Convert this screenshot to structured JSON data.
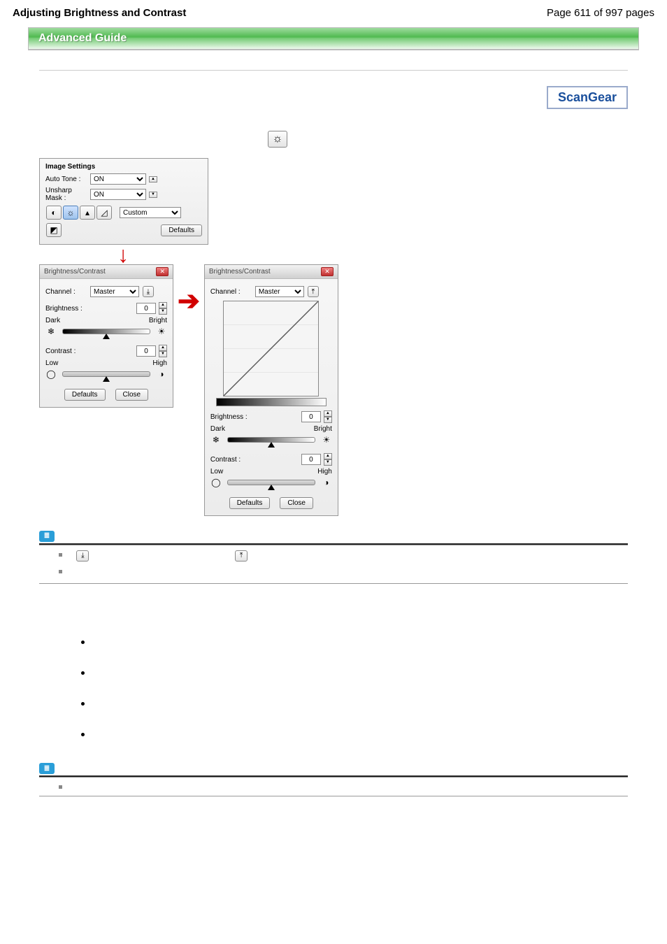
{
  "header": {
    "title": "Adjusting Brightness and Contrast",
    "page_info": "Page 611 of 997 pages"
  },
  "banner": "Advanced Guide",
  "brand": "ScanGear",
  "image_settings": {
    "title": "Image Settings",
    "rows": {
      "auto_tone_label": "Auto Tone :",
      "auto_tone_value": "ON",
      "unsharp_label": "Unsharp Mask :",
      "unsharp_value": "ON",
      "custom_value": "Custom"
    },
    "defaults_btn": "Defaults"
  },
  "dialog": {
    "title": "Brightness/Contrast",
    "channel_label": "Channel :",
    "channel_value": "Master",
    "brightness_label": "Brightness :",
    "brightness_value": "0",
    "dark": "Dark",
    "bright": "Bright",
    "contrast_label": "Contrast :",
    "contrast_value": "0",
    "low": "Low",
    "high": "High",
    "defaults": "Defaults",
    "close": "Close"
  },
  "icons": {
    "main": "☀",
    "expand": "⤓",
    "collapse": "⤒"
  }
}
